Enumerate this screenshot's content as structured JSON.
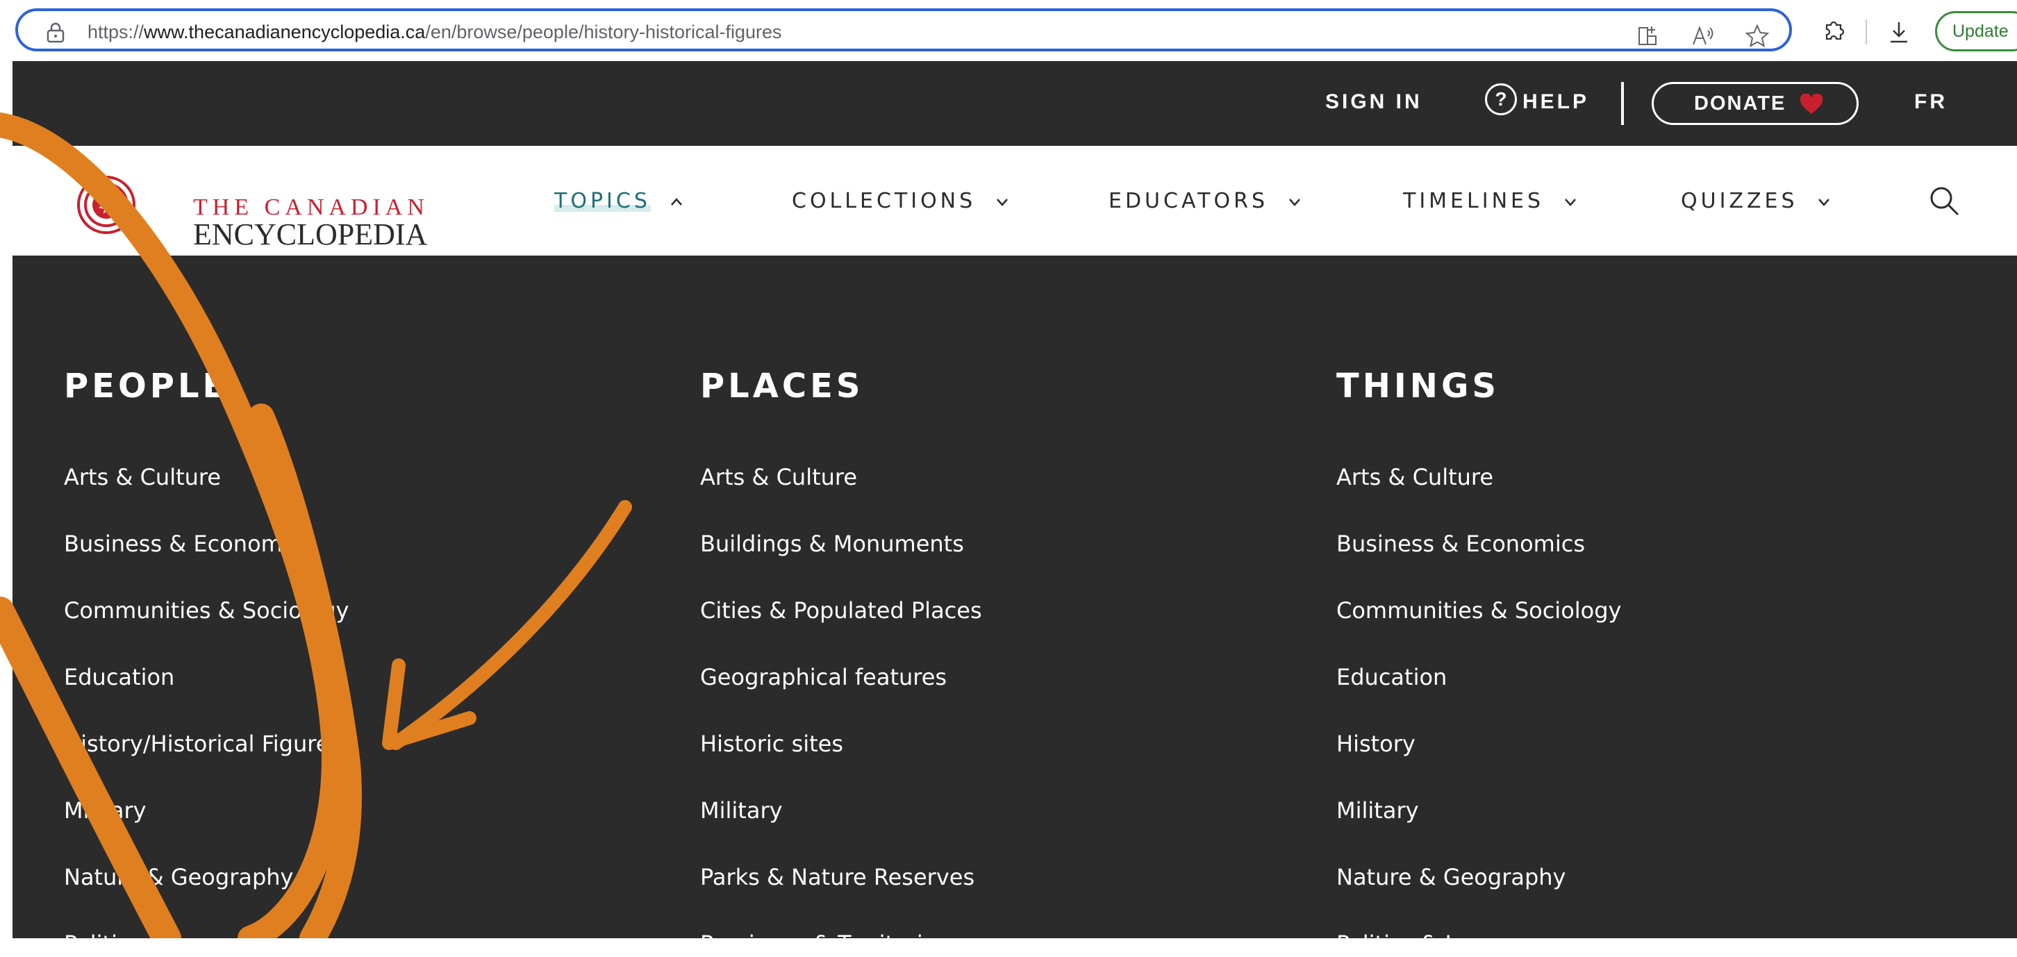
{
  "browser": {
    "url_prefix": "https://",
    "url_domain": "www.thecanadianencyclopedia.ca",
    "url_path": "/en/browse/people/history-historical-figures",
    "update_label": "Update"
  },
  "topbar": {
    "sign_in": "SIGN IN",
    "help_symbol": "?",
    "help": "HELP",
    "donate": "DONATE",
    "lang": "FR"
  },
  "logo": {
    "line1": "THE CANADIAN",
    "line2": "ENCYCLOPEDIA"
  },
  "nav": {
    "topics": "TOPICS",
    "collections": "COLLECTIONS",
    "educators": "EDUCATORS",
    "timelines": "TIMELINES",
    "quizzes": "QUIZZES"
  },
  "panel": {
    "people": {
      "title": "PEOPLE",
      "items": [
        "Arts & Culture",
        "Business & Economics",
        "Communities & Sociology",
        "Education",
        "History/Historical Figures",
        "Military",
        "Nature & Geography",
        "Politics"
      ]
    },
    "places": {
      "title": "PLACES",
      "items": [
        "Arts & Culture",
        "Buildings & Monuments",
        "Cities & Populated Places",
        "Geographical features",
        "Historic sites",
        "Military",
        "Parks & Nature Reserves",
        "Provinces & Territories"
      ]
    },
    "things": {
      "title": "THINGS",
      "items": [
        "Arts & Culture",
        "Business & Economics",
        "Communities & Sociology",
        "Education",
        "History",
        "Military",
        "Nature & Geography",
        "Politics & Law"
      ]
    }
  },
  "colors": {
    "topbar_bg": "#2b2b2b",
    "accent_red": "#c8202f",
    "active_teal": "#1f6f77",
    "annotation_orange": "#e07f1f",
    "url_focus": "#2b63d9"
  }
}
